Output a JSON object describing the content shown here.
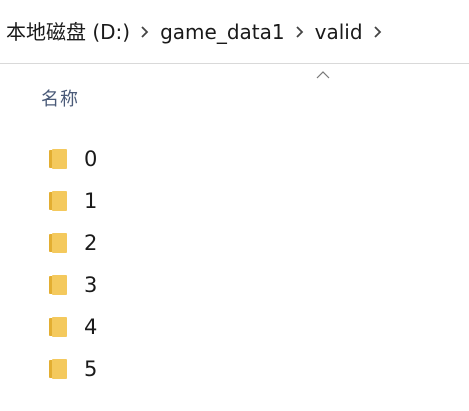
{
  "breadcrumb": {
    "items": [
      {
        "label": "本地磁盘 (D:)"
      },
      {
        "label": "game_data1"
      },
      {
        "label": "valid"
      }
    ]
  },
  "column_header": {
    "label": "名称",
    "sort": "ascending"
  },
  "files": [
    {
      "name": "0",
      "type": "folder"
    },
    {
      "name": "1",
      "type": "folder"
    },
    {
      "name": "2",
      "type": "folder"
    },
    {
      "name": "3",
      "type": "folder"
    },
    {
      "name": "4",
      "type": "folder"
    },
    {
      "name": "5",
      "type": "folder"
    }
  ],
  "colors": {
    "folder_body": "#f4c95d",
    "folder_tab": "#e3ae32",
    "header_text": "#4a5a78",
    "separator": "#d9d9d9"
  }
}
